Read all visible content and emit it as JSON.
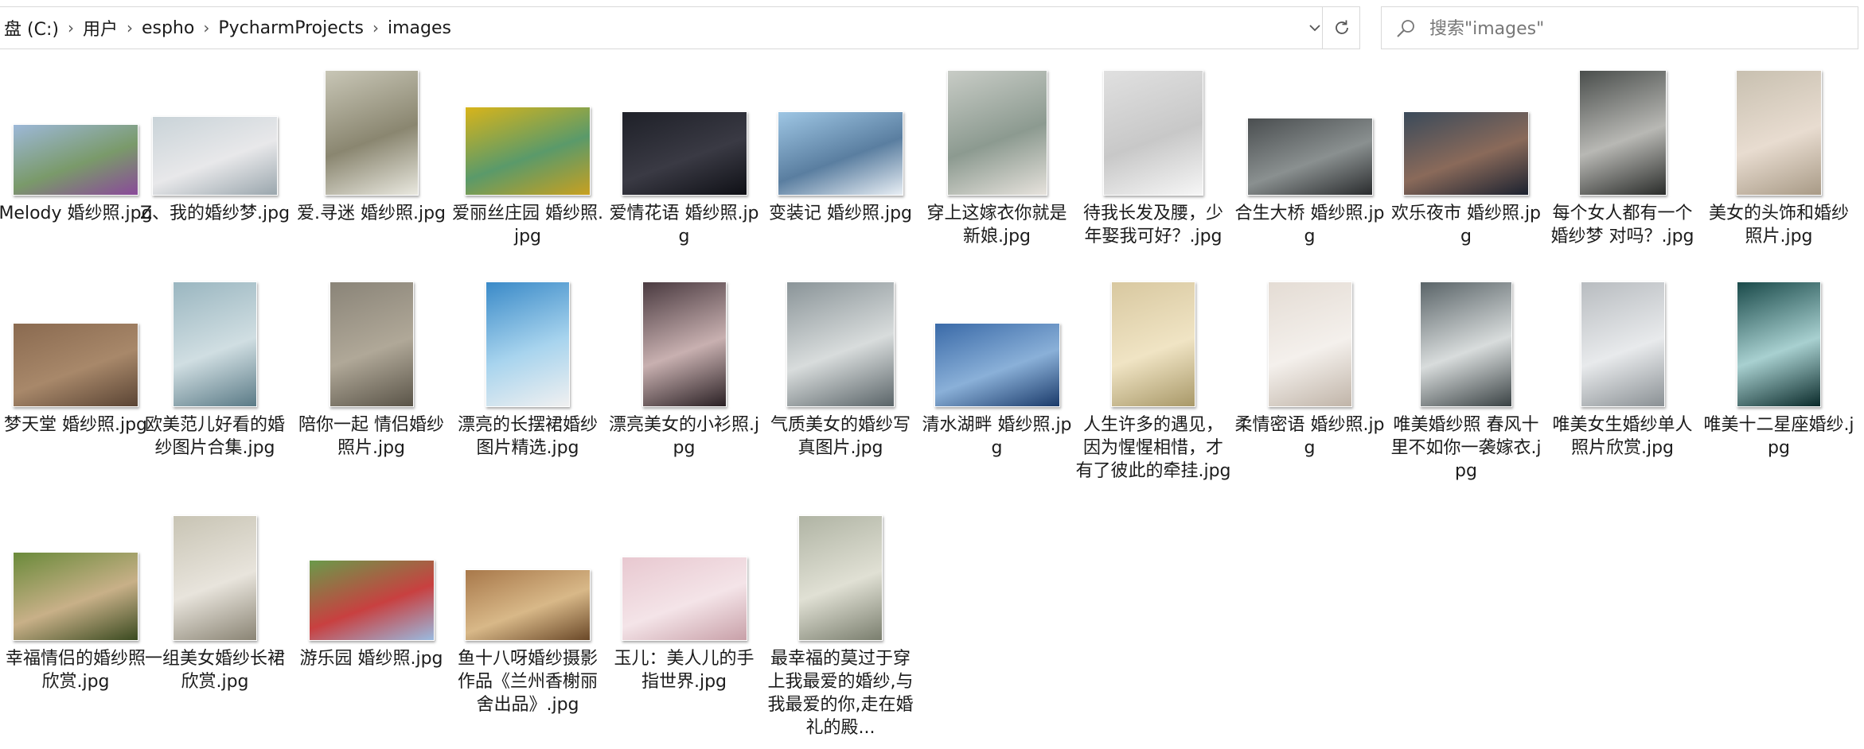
{
  "address_bar": {
    "crumbs": [
      "盘 (C:)",
      "用户",
      "espho",
      "PycharmProjects",
      "images"
    ]
  },
  "search": {
    "placeholder": "搜索\"images\""
  },
  "icons": {
    "chevron_sep": "chevron-right-icon",
    "dropdown": "chevron-down-icon",
    "refresh": "refresh-icon",
    "search": "search-icon"
  },
  "files": [
    {
      "name": "Melody 婚纱照.jpg",
      "thumb": {
        "w": 156,
        "h": 88,
        "colors": [
          "#9db8d8",
          "#7a9a6a",
          "#8a4a9a"
        ]
      }
    },
    {
      "name": "Z、我的婚纱梦.jpg",
      "thumb": {
        "w": 156,
        "h": 98,
        "colors": [
          "#c9d3d8",
          "#e8e8ea",
          "#9aa6ad"
        ]
      }
    },
    {
      "name": "爱.寻迷 婚纱照.jpg",
      "thumb": {
        "w": 116,
        "h": 156,
        "colors": [
          "#c8c6b6",
          "#8a8670",
          "#e9e8df"
        ]
      }
    },
    {
      "name": "爱丽丝庄园 婚纱照.jpg",
      "thumb": {
        "w": 156,
        "h": 110,
        "colors": [
          "#d8b41a",
          "#5a9a6a",
          "#c8a020"
        ]
      }
    },
    {
      "name": "爱情花语 婚纱照.jpg",
      "thumb": {
        "w": 156,
        "h": 104,
        "colors": [
          "#1e2028",
          "#3a3a44",
          "#0f1016"
        ]
      }
    },
    {
      "name": "变装记 婚纱照.jpg",
      "thumb": {
        "w": 156,
        "h": 104,
        "colors": [
          "#9ec6e4",
          "#5a7ea0",
          "#e8eef4"
        ]
      }
    },
    {
      "name": "穿上这嫁衣你就是新娘.jpg",
      "thumb": {
        "w": 124,
        "h": 156,
        "colors": [
          "#c8ccc6",
          "#8c9a90",
          "#e6e2dc"
        ]
      }
    },
    {
      "name": "待我长发及腰，少年娶我可好？.jpg",
      "thumb": {
        "w": 124,
        "h": 156,
        "colors": [
          "#e0e0e0",
          "#c8c8c8",
          "#f6f6f6"
        ]
      }
    },
    {
      "name": "合生大桥 婚纱照.jpg",
      "thumb": {
        "w": 156,
        "h": 96,
        "colors": [
          "#4a4e50",
          "#8a9090",
          "#2a2c2e"
        ]
      }
    },
    {
      "name": "欢乐夜市 婚纱照.jpg",
      "thumb": {
        "w": 156,
        "h": 104,
        "colors": [
          "#3a4a5a",
          "#8a6a5a",
          "#1c2230"
        ]
      }
    },
    {
      "name": "每个女人都有一个婚纱梦 对吗？.jpg",
      "thumb": {
        "w": 108,
        "h": 156,
        "colors": [
          "#4a4e4c",
          "#b8b8b4",
          "#2a2c2a"
        ]
      }
    },
    {
      "name": "美女的头饰和婚纱照片.jpg",
      "thumb": {
        "w": 106,
        "h": 156,
        "colors": [
          "#c8c0b0",
          "#e8dcd0",
          "#a89a86"
        ]
      }
    },
    {
      "name": "梦天堂 婚纱照.jpg",
      "thumb": {
        "w": 156,
        "h": 104,
        "colors": [
          "#8a6a50",
          "#a8886a",
          "#5a4434"
        ]
      }
    },
    {
      "name": "欧美范儿好看的婚纱图片合集.jpg",
      "thumb": {
        "w": 104,
        "h": 156,
        "colors": [
          "#9ab6c0",
          "#d0dee2",
          "#5a7a86"
        ]
      }
    },
    {
      "name": "陪你一起 情侣婚纱照片.jpg",
      "thumb": {
        "w": 104,
        "h": 156,
        "colors": [
          "#8a8478",
          "#b0a898",
          "#5a5448"
        ]
      }
    },
    {
      "name": "漂亮的长摆裙婚纱图片精选.jpg",
      "thumb": {
        "w": 104,
        "h": 156,
        "colors": [
          "#3a8ac8",
          "#a8d4ee",
          "#f0f0f0"
        ]
      }
    },
    {
      "name": "漂亮美女的小衫照.jpg",
      "thumb": {
        "w": 104,
        "h": 156,
        "colors": [
          "#4a3a40",
          "#c8b0b0",
          "#2a2024"
        ]
      }
    },
    {
      "name": "气质美女的婚纱写真图片.jpg",
      "thumb": {
        "w": 134,
        "h": 156,
        "colors": [
          "#8a9498",
          "#d8dcdc",
          "#5a6468"
        ]
      }
    },
    {
      "name": "清水湖畔 婚纱照.jpg",
      "thumb": {
        "w": 156,
        "h": 104,
        "colors": [
          "#3a6aa8",
          "#8ab0d8",
          "#1a3a6a"
        ]
      }
    },
    {
      "name": "人生许多的遇见，因为惺惺相惜，才有了彼此的牵挂.jpg",
      "thumb": {
        "w": 104,
        "h": 156,
        "colors": [
          "#d8c8a0",
          "#f0e4c4",
          "#a89868"
        ]
      }
    },
    {
      "name": "柔情密语 婚纱照.jpg",
      "thumb": {
        "w": 104,
        "h": 156,
        "colors": [
          "#e4dcd4",
          "#f4f0ec",
          "#c0b4a8"
        ]
      }
    },
    {
      "name": "唯美婚纱照 春风十里不如你一袭嫁衣.jpg",
      "thumb": {
        "w": 114,
        "h": 156,
        "colors": [
          "#5a6468",
          "#d8dcdc",
          "#3a4244"
        ]
      }
    },
    {
      "name": "唯美女生婚纱单人照片欣赏.jpg",
      "thumb": {
        "w": 104,
        "h": 156,
        "colors": [
          "#b8bcc0",
          "#e8eaec",
          "#8a9094"
        ]
      }
    },
    {
      "name": "唯美十二星座婚纱.jpg",
      "thumb": {
        "w": 104,
        "h": 156,
        "colors": [
          "#1a4a4a",
          "#a8d0d0",
          "#0a2a2a"
        ]
      }
    },
    {
      "name": "幸福情侣的婚纱照欣赏.jpg",
      "thumb": {
        "w": 156,
        "h": 110,
        "colors": [
          "#6a8a3a",
          "#c8b088",
          "#3a4a20"
        ]
      }
    },
    {
      "name": "一组美女婚纱长裙欣赏.jpg",
      "thumb": {
        "w": 104,
        "h": 156,
        "colors": [
          "#c8c4b4",
          "#e8e4dc",
          "#8a8474"
        ]
      }
    },
    {
      "name": "游乐园 婚纱照.jpg",
      "thumb": {
        "w": 156,
        "h": 100,
        "colors": [
          "#6a9a4a",
          "#c84040",
          "#9abae0"
        ]
      }
    },
    {
      "name": "鱼十八呀婚纱摄影作品《兰州香榭丽舍出品》.jpg",
      "thumb": {
        "w": 156,
        "h": 88,
        "colors": [
          "#a8784a",
          "#d8b888",
          "#6a4828"
        ]
      }
    },
    {
      "name": "玉儿：美人儿的手指世界.jpg",
      "thumb": {
        "w": 156,
        "h": 104,
        "colors": [
          "#e8c8d0",
          "#f4e4e8",
          "#c8a0a8"
        ]
      }
    },
    {
      "name": "最幸福的莫过于穿上我最爱的婚纱,与我最爱的你,走在婚礼的殿...",
      "thumb": {
        "w": 104,
        "h": 156,
        "colors": [
          "#b0b4a4",
          "#e0e0d4",
          "#7a7e6e"
        ]
      }
    }
  ]
}
